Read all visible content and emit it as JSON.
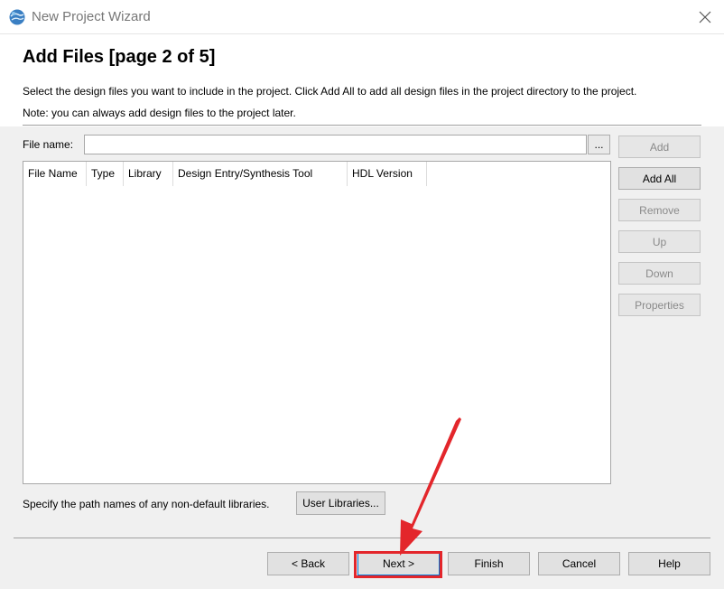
{
  "window": {
    "title": "New Project Wizard",
    "icon": "globe-app-icon",
    "close_icon": "close-icon"
  },
  "header": {
    "title": "Add Files [page 2 of 5]",
    "description_line1": "Select the design files you want to include in the project. Click Add All to add all design files in the project directory to the project.",
    "description_line2": "Note: you can always add design files to the project later."
  },
  "file_entry": {
    "label": "File name:",
    "value": "",
    "browse_label": "..."
  },
  "table": {
    "columns": [
      "File Name",
      "Type",
      "Library",
      "Design Entry/Synthesis Tool",
      "HDL Version"
    ],
    "rows": []
  },
  "side_buttons": [
    {
      "label": "Add",
      "enabled": false
    },
    {
      "label": "Add All",
      "enabled": true
    },
    {
      "label": "Remove",
      "enabled": false
    },
    {
      "label": "Up",
      "enabled": false
    },
    {
      "label": "Down",
      "enabled": false
    },
    {
      "label": "Properties",
      "enabled": false
    }
  ],
  "libraries": {
    "text": "Specify the path names of any non-default libraries.",
    "button_label": "User Libraries..."
  },
  "nav": {
    "back": "< Back",
    "next": "Next >",
    "finish": "Finish",
    "cancel": "Cancel",
    "help": "Help"
  },
  "annotation": {
    "color": "#e3262b",
    "target": "Next >"
  }
}
